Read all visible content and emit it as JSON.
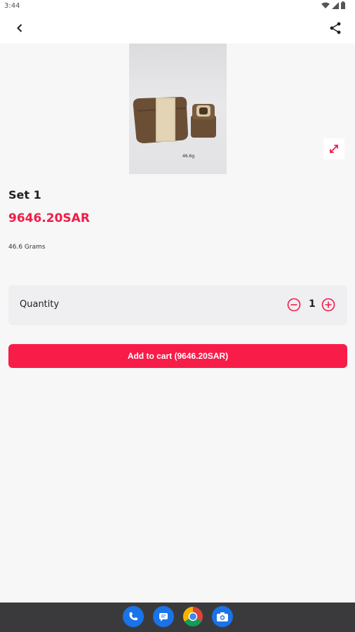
{
  "status_bar": {
    "time": "3:44"
  },
  "app_bar": {
    "back_icon": "back-arrow-icon",
    "share_icon": "share-icon"
  },
  "product": {
    "image_label": "46.6g",
    "title": "Set 1",
    "price": "9646.20SAR",
    "weight": "46.6 Grams"
  },
  "quantity": {
    "label": "Quantity",
    "value": "1"
  },
  "cart_button": {
    "label": "Add to cart (9646.20SAR)"
  },
  "colors": {
    "accent": "#f81c48",
    "background": "#f7f7f7",
    "card": "#efeff1"
  },
  "dock": {
    "apps": [
      "phone",
      "messages",
      "chrome",
      "camera"
    ]
  }
}
